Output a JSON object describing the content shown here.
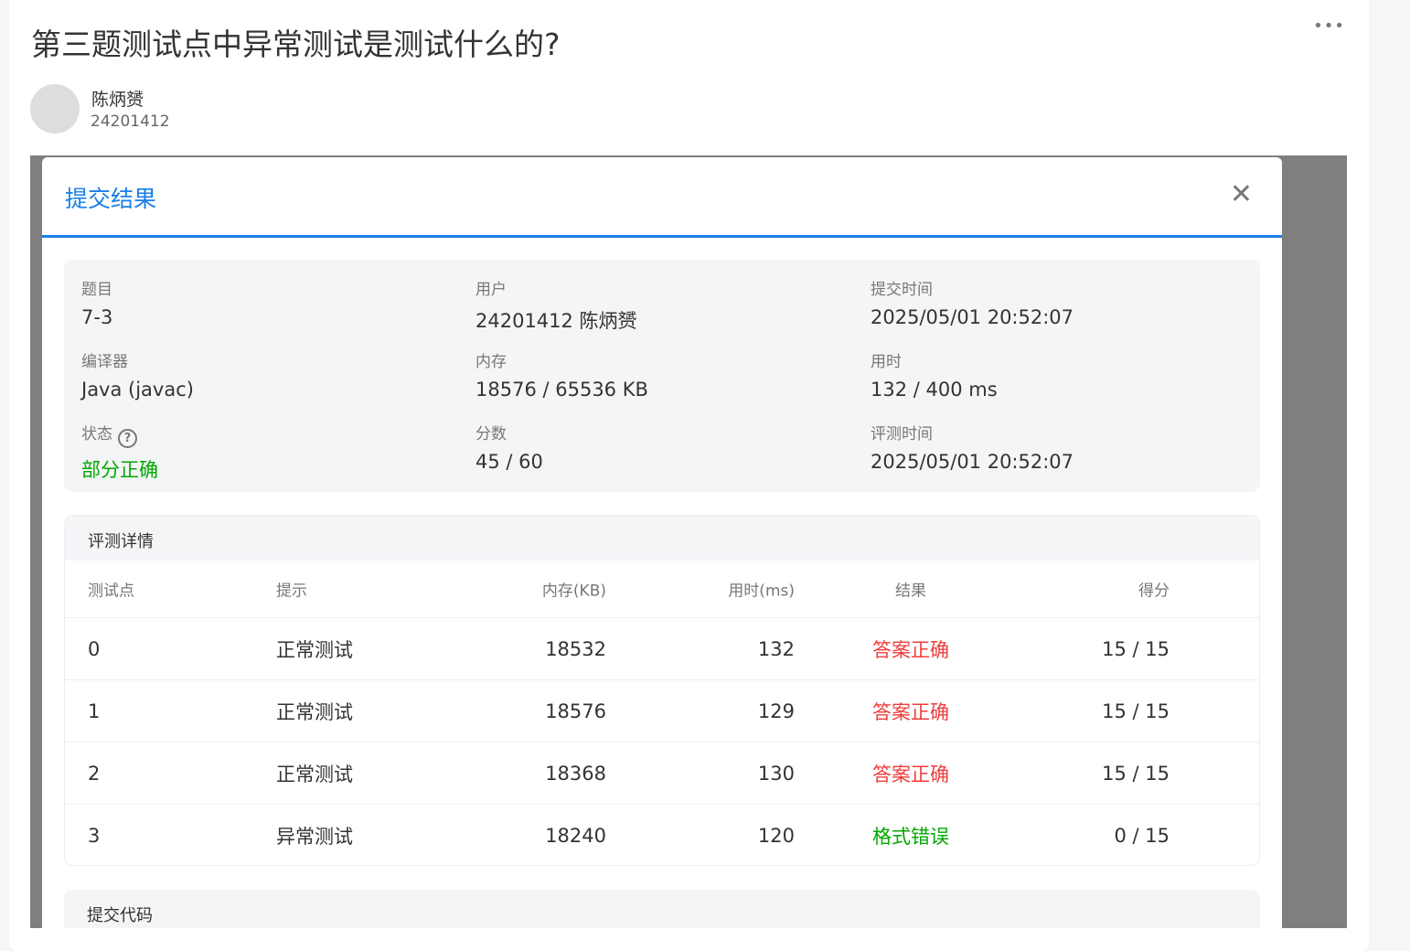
{
  "post": {
    "title": "第三题测试点中异常测试是测试什么的?",
    "author": "陈炳赟",
    "author_id": "24201412",
    "more_icon": "ellipsis-icon"
  },
  "modal": {
    "title": "提交结果",
    "close_icon": "close-icon",
    "accent": "#1a7fe8",
    "info": [
      {
        "label": "题目",
        "value": "7-3"
      },
      {
        "label": "用户",
        "value": "24201412 陈炳赟"
      },
      {
        "label": "提交时间",
        "value": "2025/05/01 20:52:07"
      },
      {
        "label": "编译器",
        "value": "Java (javac)"
      },
      {
        "label": "内存",
        "value": "18576 / 65536 KB"
      },
      {
        "label": "用时",
        "value": "132 / 400 ms"
      },
      {
        "label": "状态",
        "value": "部分正确",
        "color": "#00a800"
      },
      {
        "label": "分数",
        "value": "45 / 60"
      },
      {
        "label": "评测时间",
        "value": "2025/05/01 20:52:07"
      }
    ],
    "details": {
      "title": "评测详情",
      "columns": [
        "测试点",
        "提示",
        "内存(KB)",
        "用时(ms)",
        "结果",
        "得分"
      ],
      "rows": [
        {
          "id": "0",
          "hint": "正常测试",
          "mem": "18532",
          "time": "132",
          "result": "答案正确",
          "color": "#f03c3c",
          "score": "15 / 15"
        },
        {
          "id": "1",
          "hint": "正常测试",
          "mem": "18576",
          "time": "129",
          "result": "答案正确",
          "color": "#f03c3c",
          "score": "15 / 15"
        },
        {
          "id": "2",
          "hint": "正常测试",
          "mem": "18368",
          "time": "130",
          "result": "答案正确",
          "color": "#f03c3c",
          "score": "15 / 15"
        },
        {
          "id": "3",
          "hint": "异常测试",
          "mem": "18240",
          "time": "120",
          "result": "格式错误",
          "color": "#00a800",
          "score": "0 / 15"
        }
      ]
    },
    "code_title": "提交代码"
  }
}
